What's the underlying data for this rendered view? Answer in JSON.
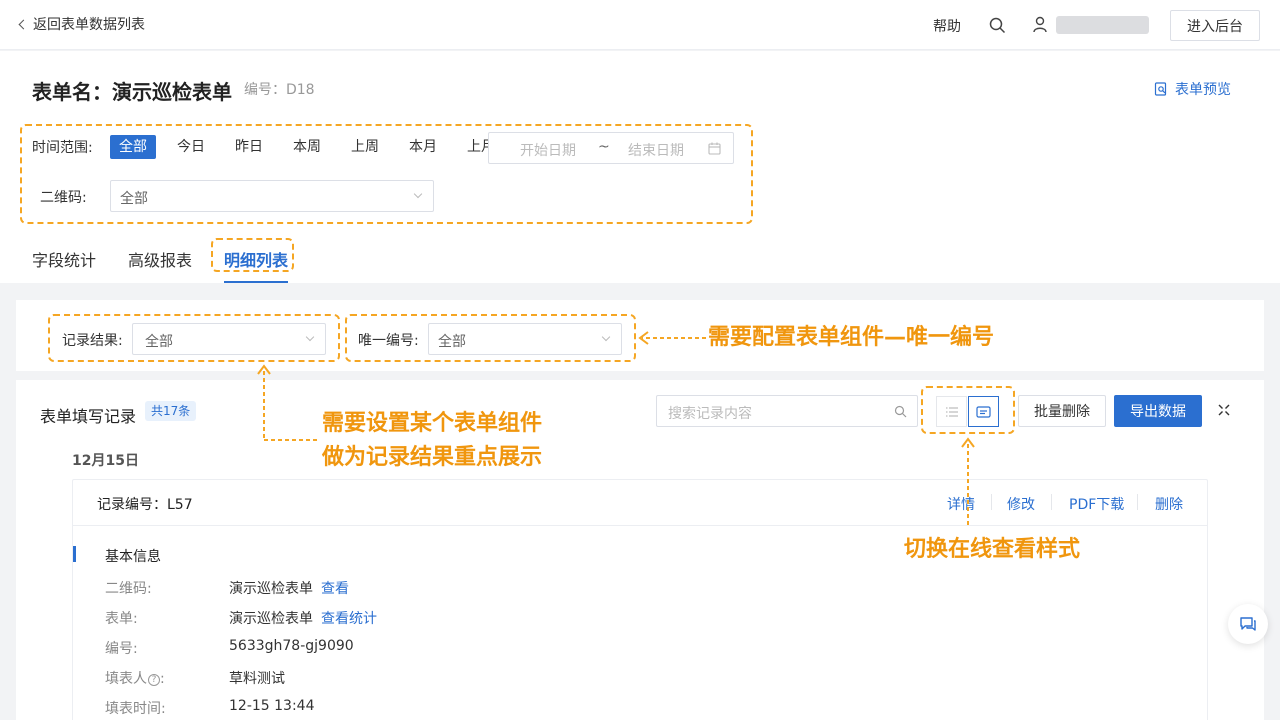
{
  "topbar": {
    "back_label": "返回表单数据列表",
    "help_label": "帮助",
    "backend_label": "进入后台"
  },
  "header": {
    "title": "表单名：演示巡检表单",
    "code": "编号：D18",
    "preview_label": "表单预览"
  },
  "filters": {
    "time_label": "时间范围:",
    "time_options": [
      "全部",
      "今日",
      "昨日",
      "本周",
      "上周",
      "本月",
      "上月"
    ],
    "date_start_placeholder": "开始日期",
    "date_separator": "~",
    "date_end_placeholder": "结束日期",
    "qr_label": "二维码:",
    "qr_value": "全部"
  },
  "tabs": [
    "字段统计",
    "高级报表",
    "明细列表"
  ],
  "sub_filters": {
    "result_label": "记录结果:",
    "result_value": "全部",
    "unique_label": "唯一编号:",
    "unique_value": "全部"
  },
  "records": {
    "title": "表单填写记录",
    "count": "共17条",
    "search_placeholder": "搜索记录内容",
    "bulk_delete_label": "批量删除",
    "export_label": "导出数据",
    "date_group": "12月15日"
  },
  "card": {
    "title": "记录编号：L57",
    "actions": [
      "详情",
      "修改",
      "PDF下载",
      "删除"
    ],
    "section_title": "基本信息",
    "fields": [
      {
        "label": "二维码:",
        "value": "演示巡检表单",
        "link": "查看"
      },
      {
        "label": "表单:",
        "value": "演示巡检表单",
        "link": "查看统计"
      },
      {
        "label": "编号:",
        "value": "5633gh78-gj9090",
        "link": ""
      },
      {
        "label": "填表人",
        "value": "草料测试",
        "link": ""
      },
      {
        "label": "填表时间:",
        "value": "12-15 13:44",
        "link": ""
      }
    ]
  },
  "annotations": {
    "unique_note": "需要配置表单组件—唯一编号",
    "result_note_line1": "需要设置某个表单组件",
    "result_note_line2": "做为记录结果重点展示",
    "switch_note": "切换在线查看样式"
  },
  "colors": {
    "primary": "#2b6fd0",
    "annotation": "#f5a623"
  }
}
